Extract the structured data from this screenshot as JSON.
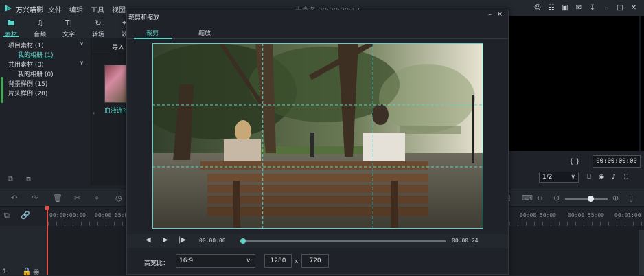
{
  "app": {
    "name": "万兴喵影",
    "menu": [
      "文件",
      "编辑",
      "工具",
      "视图"
    ],
    "doc_title": "未命名 00:00:00:12"
  },
  "media_tabs": [
    {
      "label": "素材",
      "icon": "folder-icon",
      "active": true
    },
    {
      "label": "音频",
      "icon": "music-note-icon",
      "active": false
    },
    {
      "label": "文字",
      "icon": "text-icon",
      "active": false
    },
    {
      "label": "转场",
      "icon": "transition-icon",
      "active": false
    },
    {
      "label": "效",
      "icon": "effects-icon",
      "active": false
    }
  ],
  "tree": {
    "items": [
      {
        "label": "项目素材 (1)",
        "level": 0,
        "expandable": true
      },
      {
        "label": "我的相册 (1)",
        "level": 1,
        "selected": true
      },
      {
        "label": "共用素材 (0)",
        "level": 0,
        "expandable": true
      },
      {
        "label": "我的相册 (0)",
        "level": 1
      },
      {
        "label": "背景样例 (15)",
        "level": 0
      },
      {
        "label": "片头样例 (20)",
        "level": 0
      }
    ]
  },
  "media_browser": {
    "import_label": "导入",
    "clip_label": "血液连接"
  },
  "preview": {
    "timecode": "00:00:00:00",
    "ratio": "1/2",
    "braces": "{ }"
  },
  "timeline": {
    "ruler_labels": [
      "00:00:00:00",
      "00:00:05:00",
      "00:00:50:00",
      "00:00:55:00",
      "00:01:00"
    ],
    "track_label": "1"
  },
  "dialog": {
    "title": "裁剪和缩放",
    "tabs": [
      "裁剪",
      "缩放"
    ],
    "current_time": "00:00:00",
    "duration": "00:00:24",
    "ratio_label": "高宽比：",
    "ratio_value": "16:9",
    "width": "1280",
    "height": "720",
    "times_sign": "x"
  },
  "colors": {
    "accent": "#5fd2c8",
    "background": "#1f2329",
    "playhead": "#e0504a"
  }
}
